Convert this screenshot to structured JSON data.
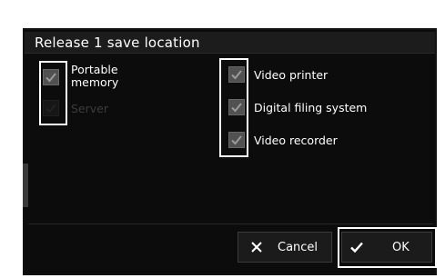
{
  "dialog": {
    "title": "Release 1 save location"
  },
  "options_left": [
    {
      "label_line1": "Portable",
      "label_line2": "memory",
      "checked": true,
      "enabled": true
    },
    {
      "label": "Server",
      "checked": false,
      "enabled": false
    }
  ],
  "options_right": [
    {
      "label": "Video printer",
      "checked": true
    },
    {
      "label": "Digital filing system",
      "checked": true
    },
    {
      "label": "Video recorder",
      "checked": true
    }
  ],
  "buttons": {
    "cancel_label": "Cancel",
    "ok_label": "OK"
  },
  "icons": {
    "check": "check-icon",
    "cancel": "close-icon",
    "ok": "checkmark-icon"
  },
  "colors": {
    "background": "#0c0c0c",
    "checkbox": "#515151",
    "check_mark": "#9a9a9a",
    "highlight": "#ffffff"
  }
}
